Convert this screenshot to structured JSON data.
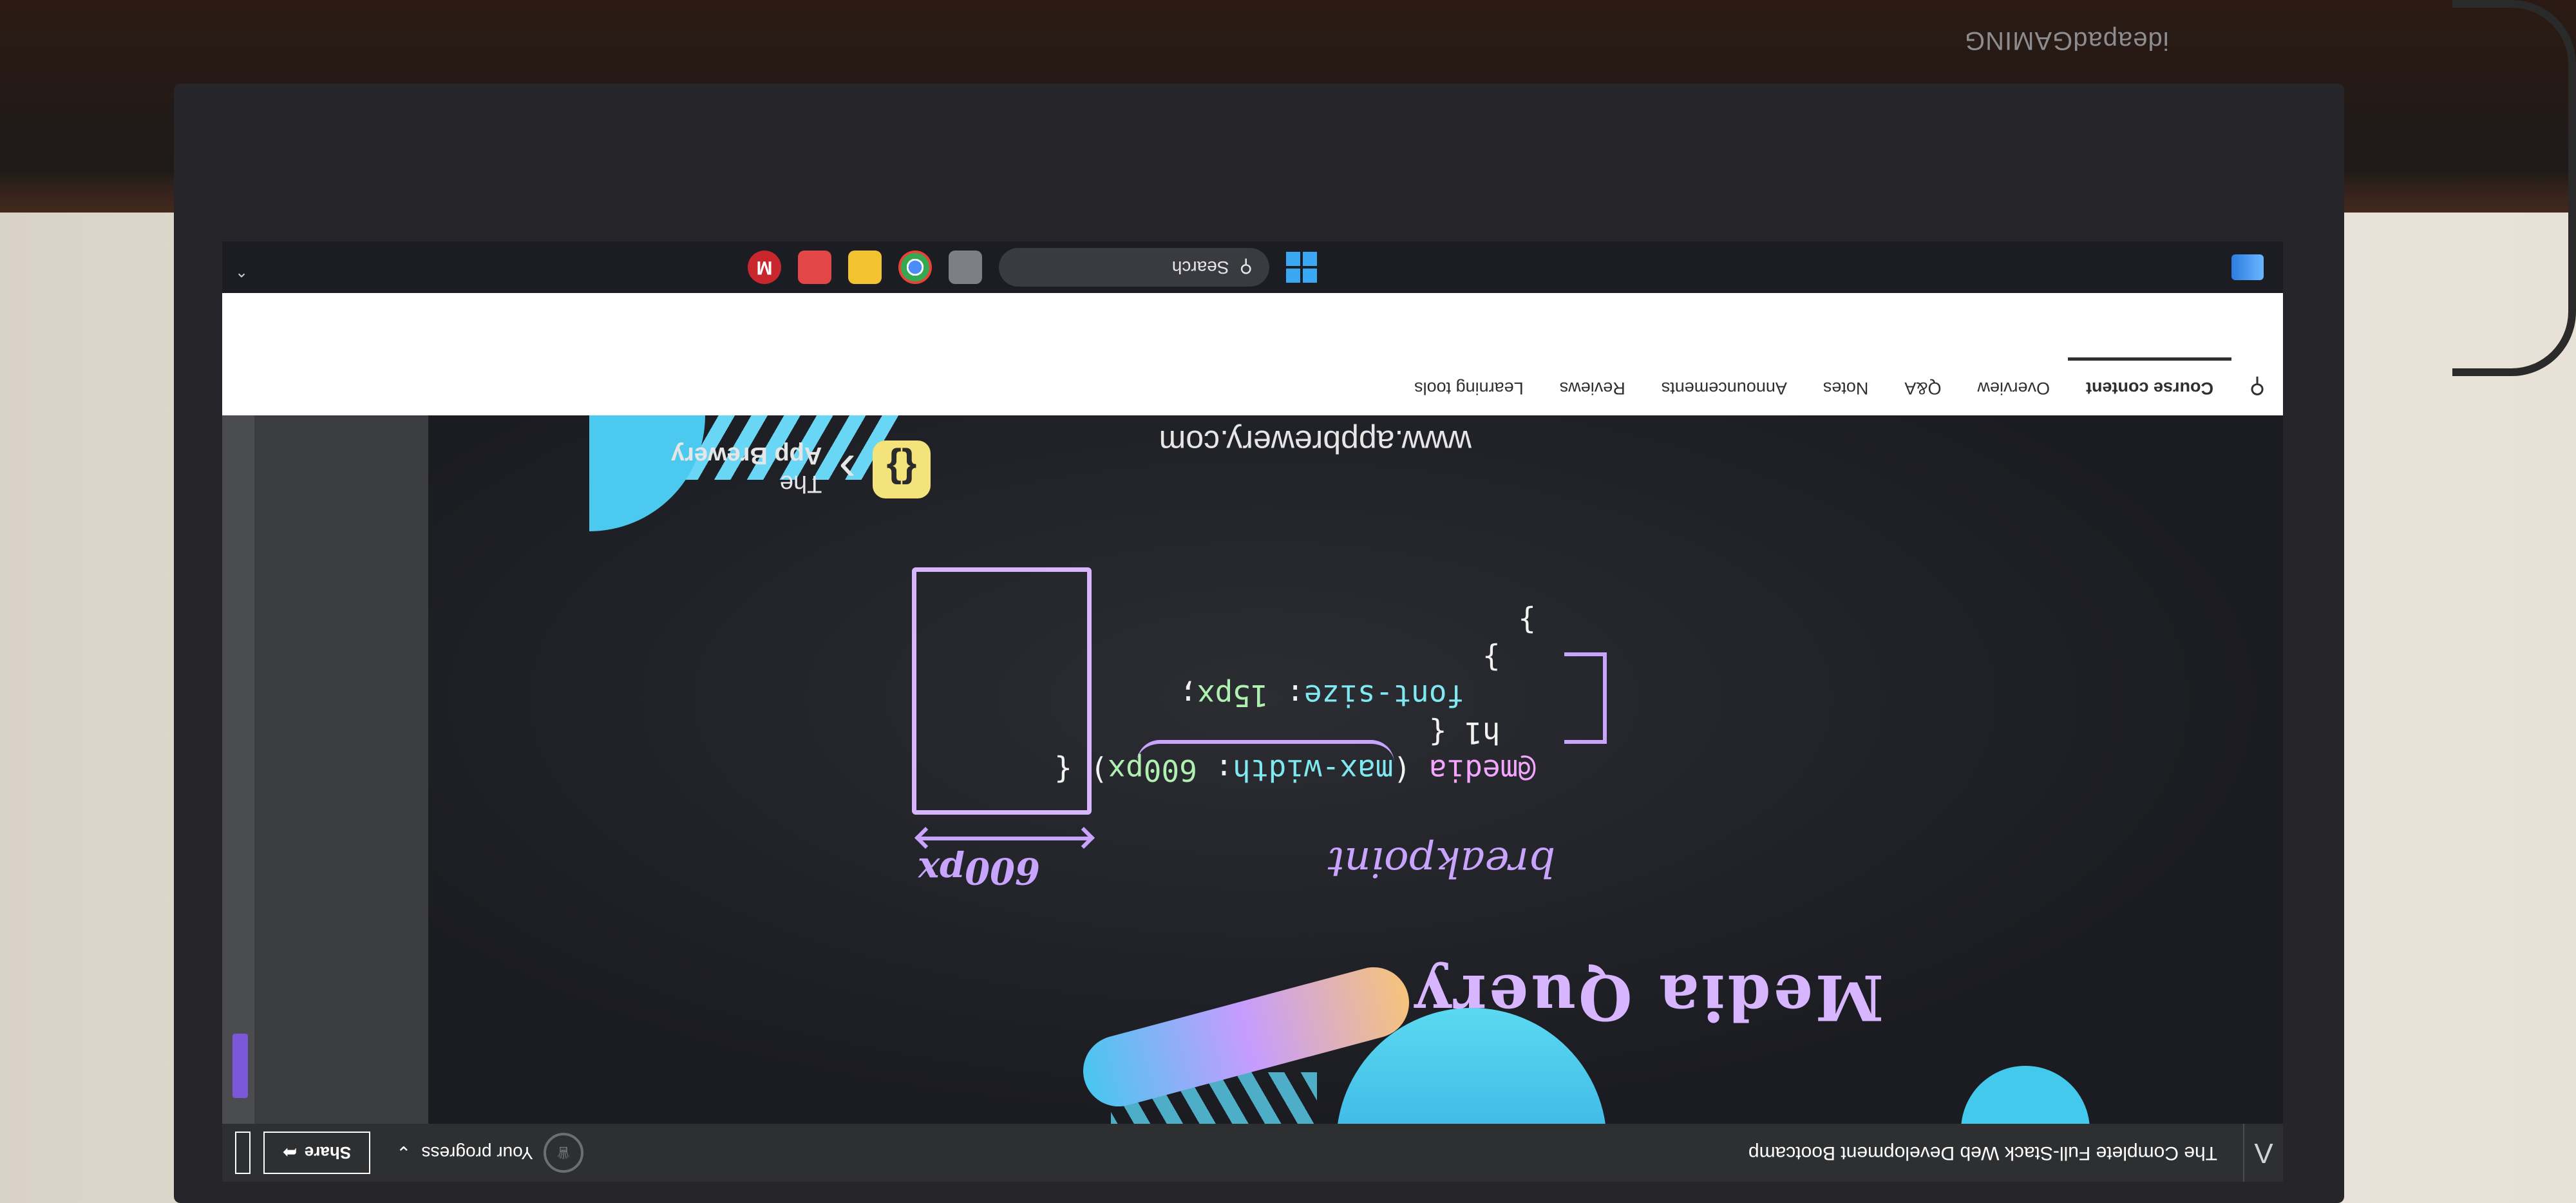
{
  "header": {
    "course_title": "The Complete Full-Stack Web Development Bootcamp",
    "progress_label": "Your progress",
    "share_label": "Share"
  },
  "slide": {
    "title": "Media Query",
    "breakpoint_note": "breakpoint",
    "width_note": "600px",
    "code_line1_a": "@media",
    "code_line1_b": " (",
    "code_line1_c": "max-width",
    "code_line1_d": ": ",
    "code_line1_e": "600px",
    "code_line1_f": ") {",
    "code_line2": "  h1 {",
    "code_line3_a": "    font-size",
    "code_line3_b": ": ",
    "code_line3_c": "15px",
    "code_line3_d": ";",
    "code_line4": "  }",
    "code_line5": "}",
    "url": "www.appbrewery.com",
    "brand_line1": "The",
    "brand_line2": "App Brewery"
  },
  "tabs": [
    {
      "label": "Course content"
    },
    {
      "label": "Overview"
    },
    {
      "label": "Q&A"
    },
    {
      "label": "Notes"
    },
    {
      "label": "Announcements"
    },
    {
      "label": "Reviews"
    },
    {
      "label": "Learning tools"
    }
  ],
  "taskbar": {
    "search_label": "Search"
  },
  "device": {
    "brand": "ideapadGAMING"
  }
}
